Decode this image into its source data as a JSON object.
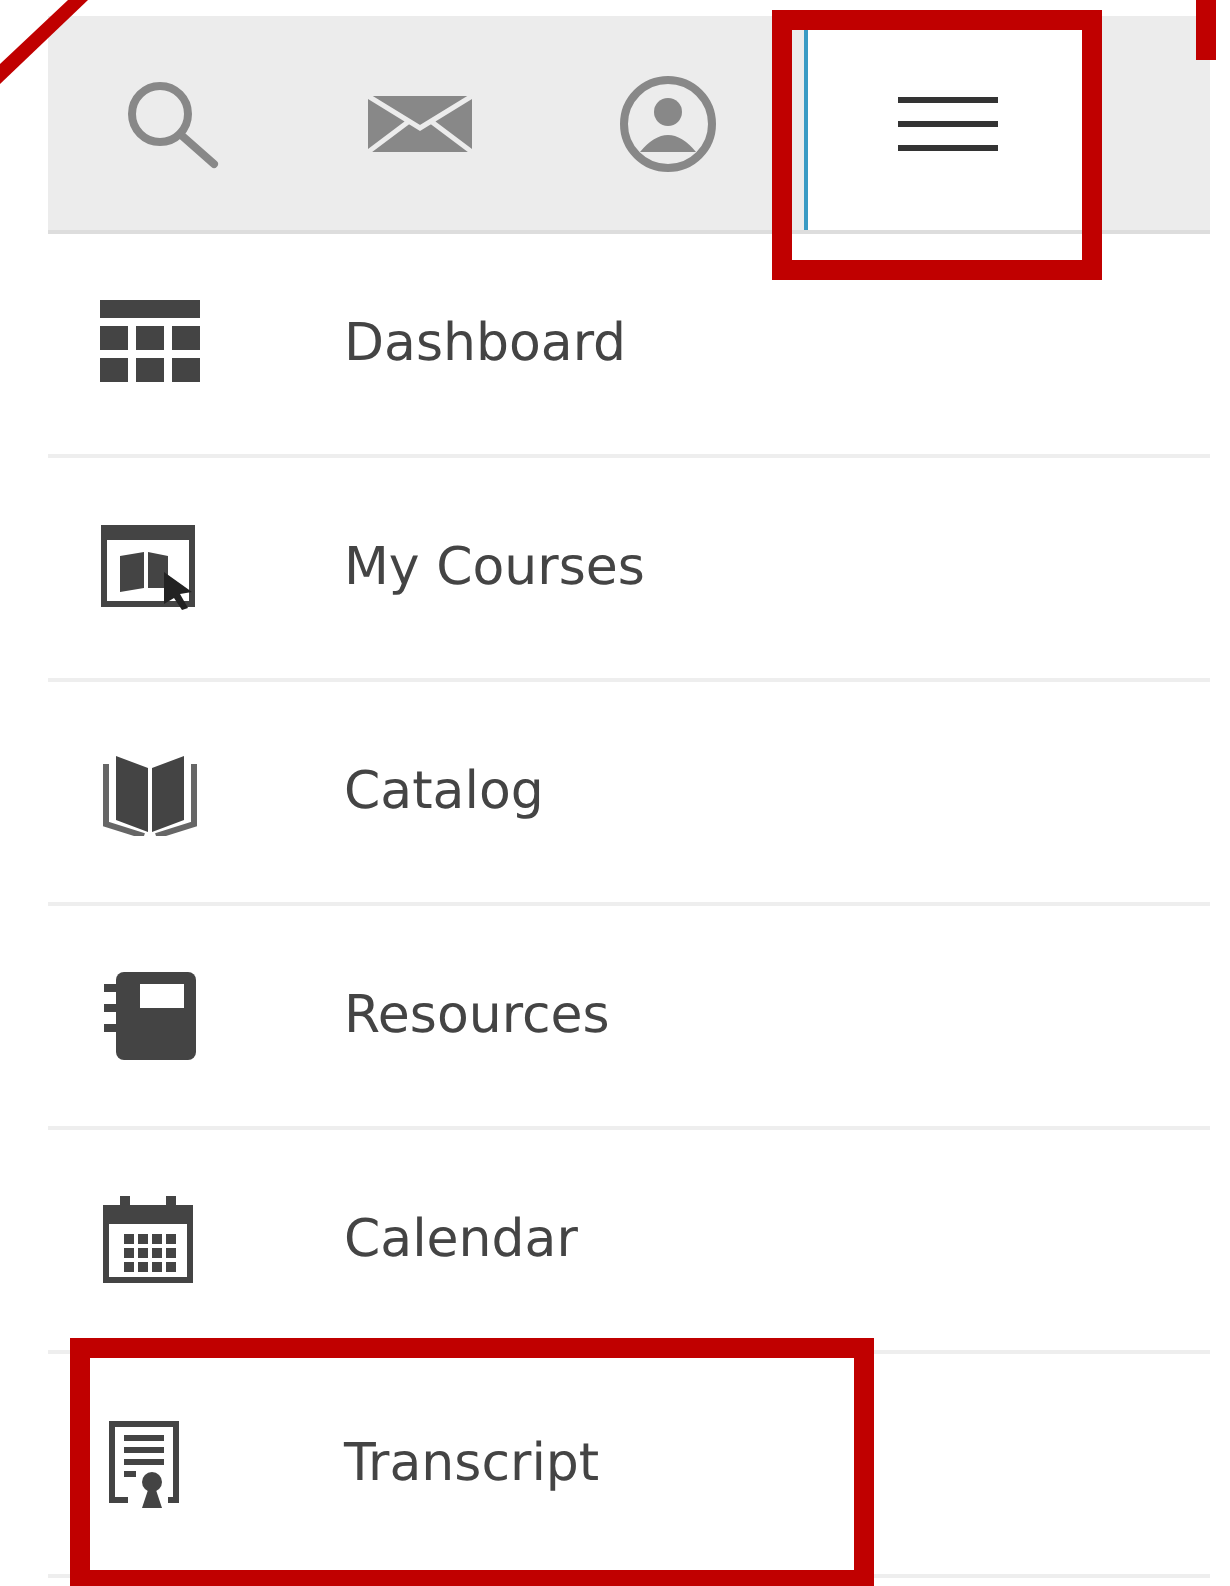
{
  "toolbar": {
    "tabs": [
      {
        "kind": "search",
        "selected": false,
        "highlighted": false
      },
      {
        "kind": "mail",
        "selected": false,
        "highlighted": false
      },
      {
        "kind": "profile",
        "selected": false,
        "highlighted": false
      },
      {
        "kind": "menu",
        "selected": true,
        "highlighted": true
      }
    ]
  },
  "menu": {
    "items": [
      {
        "kind": "dashboard",
        "label": "Dashboard",
        "highlighted": false
      },
      {
        "kind": "courses",
        "label": "My Courses",
        "highlighted": false
      },
      {
        "kind": "catalog",
        "label": "Catalog",
        "highlighted": false
      },
      {
        "kind": "resources",
        "label": "Resources",
        "highlighted": false
      },
      {
        "kind": "calendar",
        "label": "Calendar",
        "highlighted": false
      },
      {
        "kind": "transcript",
        "label": "Transcript",
        "highlighted": true
      }
    ]
  }
}
